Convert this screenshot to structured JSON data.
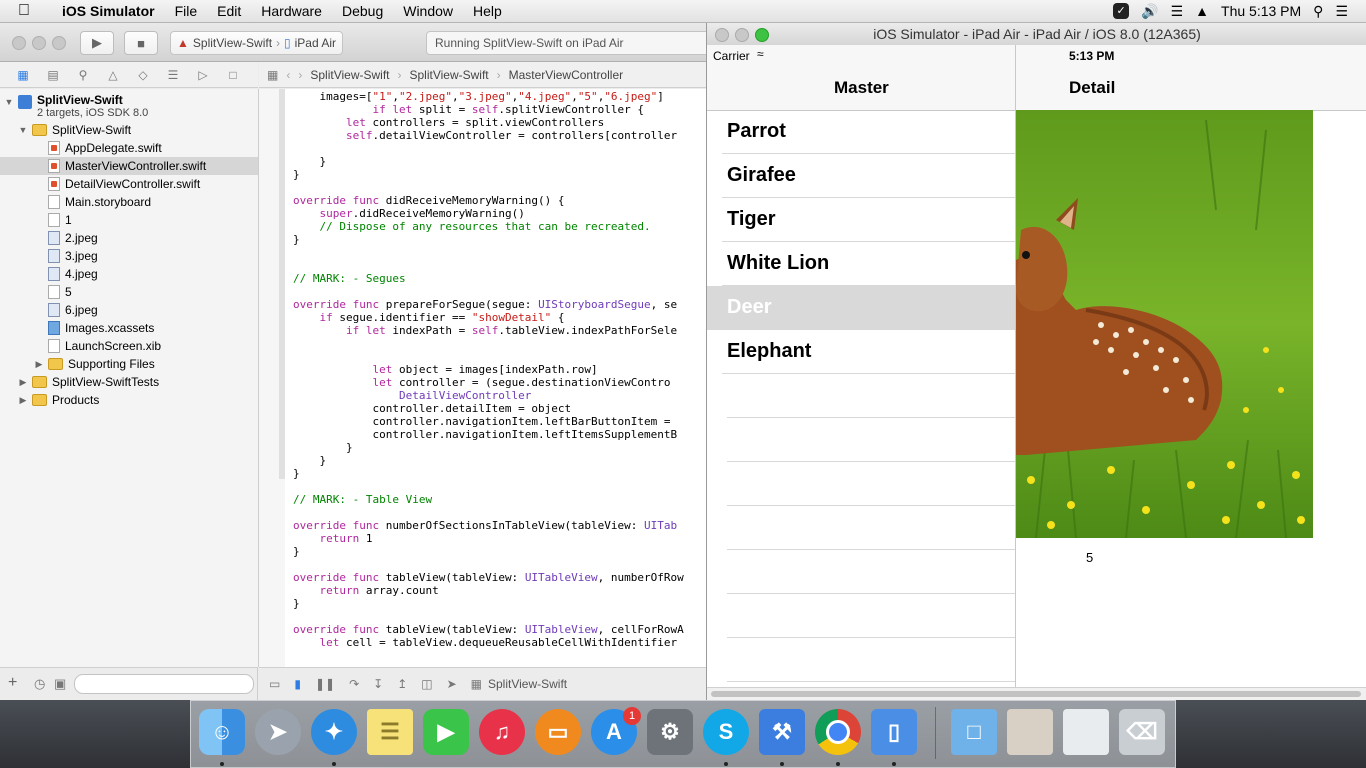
{
  "menubar": {
    "app_name": "iOS Simulator",
    "items": [
      "File",
      "Edit",
      "Hardware",
      "Debug",
      "Window",
      "Help"
    ],
    "clock": "Thu 5:13 PM"
  },
  "xcode": {
    "scheme": "SplitView-Swift",
    "device": "iPad Air",
    "status": "Running SplitView-Swift on iPad Air",
    "jumpbar": [
      "SplitView-Swift",
      "SplitView-Swift",
      "MasterViewController"
    ],
    "debug_target": "SplitView-Swift",
    "navigator": {
      "project": "SplitView-Swift",
      "project_subtitle": "2 targets, iOS SDK 8.0",
      "group": "SplitView-Swift",
      "files": [
        "AppDelegate.swift",
        "MasterViewController.swift",
        "DetailViewController.swift",
        "Main.storyboard",
        "1",
        "2.jpeg",
        "3.jpeg",
        "4.jpeg",
        "5",
        "6.jpeg",
        "Images.xcassets",
        "LaunchScreen.xib",
        "Supporting Files"
      ],
      "other_groups": [
        "SplitView-SwiftTests",
        "Products"
      ]
    },
    "code_lines": [
      "    images=[\"1\",\"2.jpeg\",\"3.jpeg\",\"4.jpeg\",\"5\",\"6.jpeg\"]",
      "            if let split = self.splitViewController {",
      "        let controllers = split.viewControllers",
      "        self.detailViewController = controllers[controller",
      "",
      "    }",
      "}",
      "",
      "override func didReceiveMemoryWarning() {",
      "    super.didReceiveMemoryWarning()",
      "    // Dispose of any resources that can be recreated.",
      "}",
      "",
      "",
      "// MARK: - Segues",
      "",
      "override func prepareForSegue(segue: UIStoryboardSegue, se",
      "    if segue.identifier == \"showDetail\" {",
      "        if let indexPath = self.tableView.indexPathForSele",
      "",
      "",
      "            let object = images[indexPath.row]",
      "            let controller = (segue.destinationViewContro",
      "                DetailViewController",
      "            controller.detailItem = object",
      "            controller.navigationItem.leftBarButtonItem =",
      "            controller.navigationItem.leftItemsSupplementB",
      "        }",
      "    }",
      "}",
      "",
      "// MARK: - Table View",
      "",
      "override func numberOfSectionsInTableView(tableView: UITab",
      "    return 1",
      "}",
      "",
      "override func tableView(tableView: UITableView, numberOfRow",
      "    return array.count",
      "}",
      "",
      "override func tableView(tableView: UITableView, cellForRowA",
      "    let cell = tableView.dequeueReusableCellWithIdentifier"
    ]
  },
  "simulator": {
    "window_title": "iOS Simulator - iPad Air - iPad Air / iOS 8.0 (12A365)",
    "carrier": "Carrier",
    "time": "5:13 PM",
    "master_title": "Master",
    "detail_title": "Detail",
    "animals": [
      "Parrot",
      "Girafee",
      "Tiger",
      "White Lion",
      "Deer",
      "Elephant"
    ],
    "selected_index": 4,
    "detail_label": "5"
  },
  "dock": {
    "apps": [
      "finder-icon",
      "launchpad-icon",
      "safari-icon",
      "notes-icon",
      "facetime-icon",
      "itunes-icon",
      "ibooks-icon",
      "app-store-icon",
      "system-preferences-icon",
      "skype-icon",
      "xcode-icon",
      "chrome-icon",
      "ios-simulator-icon"
    ],
    "app_store_badge": "1"
  }
}
